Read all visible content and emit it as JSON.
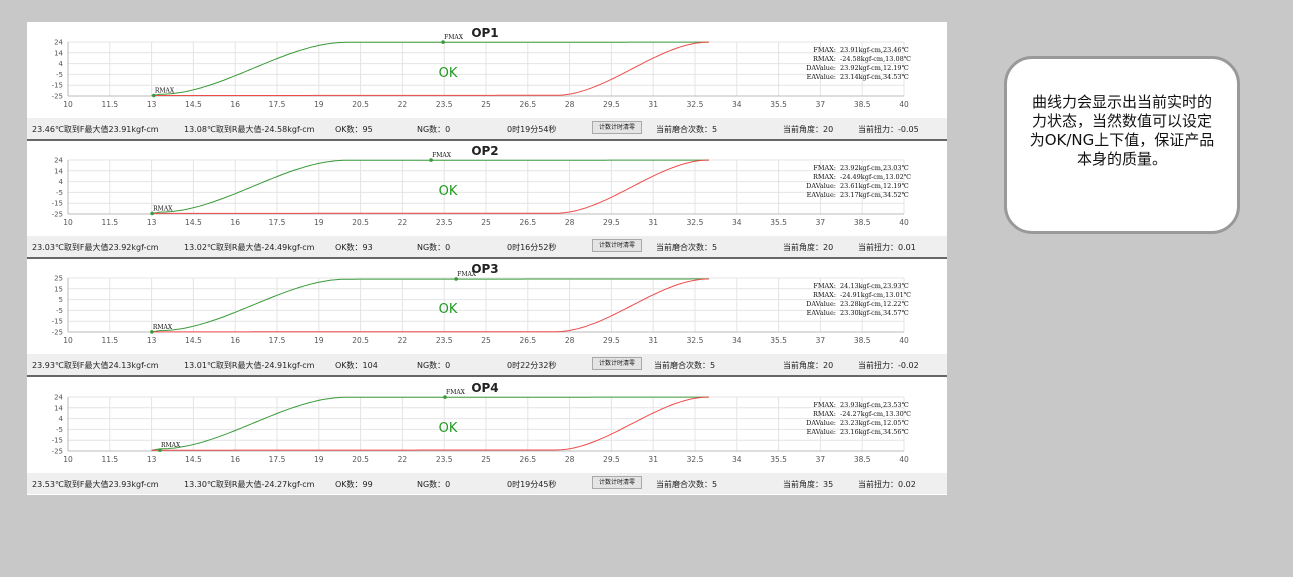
{
  "colors": {
    "push": "#3a9a3a",
    "pull": "#ef4b4b",
    "ok": "#1e9a1e",
    "grid": "#e4e4e4",
    "axis": "#555555"
  },
  "note": "曲线力会显示出当前实时的力状态，当然数值可以设定为OK/NG上下值，保证产品本身的质量。",
  "shared": {
    "x_ticks": [
      "10",
      "11.5",
      "13",
      "14.5",
      "16",
      "17.5",
      "19",
      "20.5",
      "22",
      "23.5",
      "25",
      "26.5",
      "28",
      "29.5",
      "31",
      "32.5",
      "34",
      "35.5",
      "37",
      "38.5",
      "40"
    ],
    "ok_label": "OK",
    "fmax_label": "FMAX",
    "rmax_label": "RMAX",
    "reset_button": "计数计时清零"
  },
  "ops": [
    {
      "title": "OP1",
      "y_ticks": [
        "24",
        "14",
        "4",
        "-5",
        "-15",
        "-25"
      ],
      "ylim": [
        -25,
        24
      ],
      "legend": [
        "FMAX:  23.91kgf-cm,23.46℃",
        "RMAX:  -24.58kgf-cm,13.08℃",
        "DAValue:  23.92kgf-cm,12.19℃",
        "EAValue:  23.14kgf-cm,34.53℃"
      ],
      "fmax_point": [
        23.46,
        23.91
      ],
      "rmax_point": [
        13.08,
        -24.58
      ],
      "status": {
        "f_text": "23.46℃取到F最大值23.91kgf-cm",
        "r_text": "13.08℃取到R最大值-24.58kgf-cm",
        "ok_count": "OK数：95",
        "ng_count": "NG数：0",
        "time": "0时19分54秒",
        "mesh": "当前磨合次数：5",
        "angle": "当前角度：20",
        "torque": "当前扭力：-0.05"
      }
    },
    {
      "title": "OP2",
      "y_ticks": [
        "24",
        "14",
        "4",
        "-5",
        "-15",
        "-25"
      ],
      "ylim": [
        -25,
        24
      ],
      "legend": [
        "FMAX:  23.92kgf-cm,23.03℃",
        "RMAX:  -24.49kgf-cm,13.02℃",
        "DAValue:  23.61kgf-cm,12.19℃",
        "EAValue:  23.17kgf-cm,34.52℃"
      ],
      "fmax_point": [
        23.03,
        23.92
      ],
      "rmax_point": [
        13.02,
        -24.49
      ],
      "status": {
        "f_text": "23.03℃取到F最大值23.92kgf-cm",
        "r_text": "13.02℃取到R最大值-24.49kgf-cm",
        "ok_count": "OK数：93",
        "ng_count": "NG数：0",
        "time": "0时16分52秒",
        "mesh": "当前磨合次数：5",
        "angle": "当前角度：20",
        "torque": "当前扭力：0.01"
      }
    },
    {
      "title": "OP3",
      "y_ticks": [
        "25",
        "15",
        "5",
        "-5",
        "-15",
        "-25"
      ],
      "ylim": [
        -25,
        25
      ],
      "legend": [
        "FMAX:  24.13kgf-cm,23.93℃",
        "RMAX:  -24.91kgf-cm,13.01℃",
        "DAValue:  23.28kgf-cm,12.22℃",
        "EAValue:  23.30kgf-cm,34.57℃"
      ],
      "fmax_point": [
        23.93,
        24.13
      ],
      "rmax_point": [
        13.01,
        -24.91
      ],
      "status": {
        "f_text": "23.93℃取到F最大值24.13kgf-cm",
        "r_text": "13.01℃取到R最大值-24.91kgf-cm",
        "ok_count": "OK数：104",
        "ng_count": "NG数：0",
        "time": "0时22分32秒",
        "mesh": "当前磨合次数：5",
        "angle": "当前角度：20",
        "torque": "当前扭力：-0.02"
      }
    },
    {
      "title": "OP4",
      "y_ticks": [
        "24",
        "14",
        "4",
        "-5",
        "-15",
        "-25"
      ],
      "ylim": [
        -25,
        24
      ],
      "legend": [
        "FMAX:  23.93kgf-cm,23.53℃",
        "RMAX:  -24.27kgf-cm,13.30℃",
        "DAValue:  23.23kgf-cm,12.05℃",
        "EAValue:  23.16kgf-cm,34.56℃"
      ],
      "fmax_point": [
        23.53,
        23.93
      ],
      "rmax_point": [
        13.3,
        -24.27
      ],
      "status": {
        "f_text": "23.53℃取到F最大值23.93kgf-cm",
        "r_text": "13.30℃取到R最大值-24.27kgf-cm",
        "ok_count": "OK数：99",
        "ng_count": "NG数：0",
        "time": "0时19分45秒",
        "mesh": "当前磨合次数：5",
        "angle": "当前角度：35",
        "torque": "当前扭力：0.02"
      }
    }
  ]
}
